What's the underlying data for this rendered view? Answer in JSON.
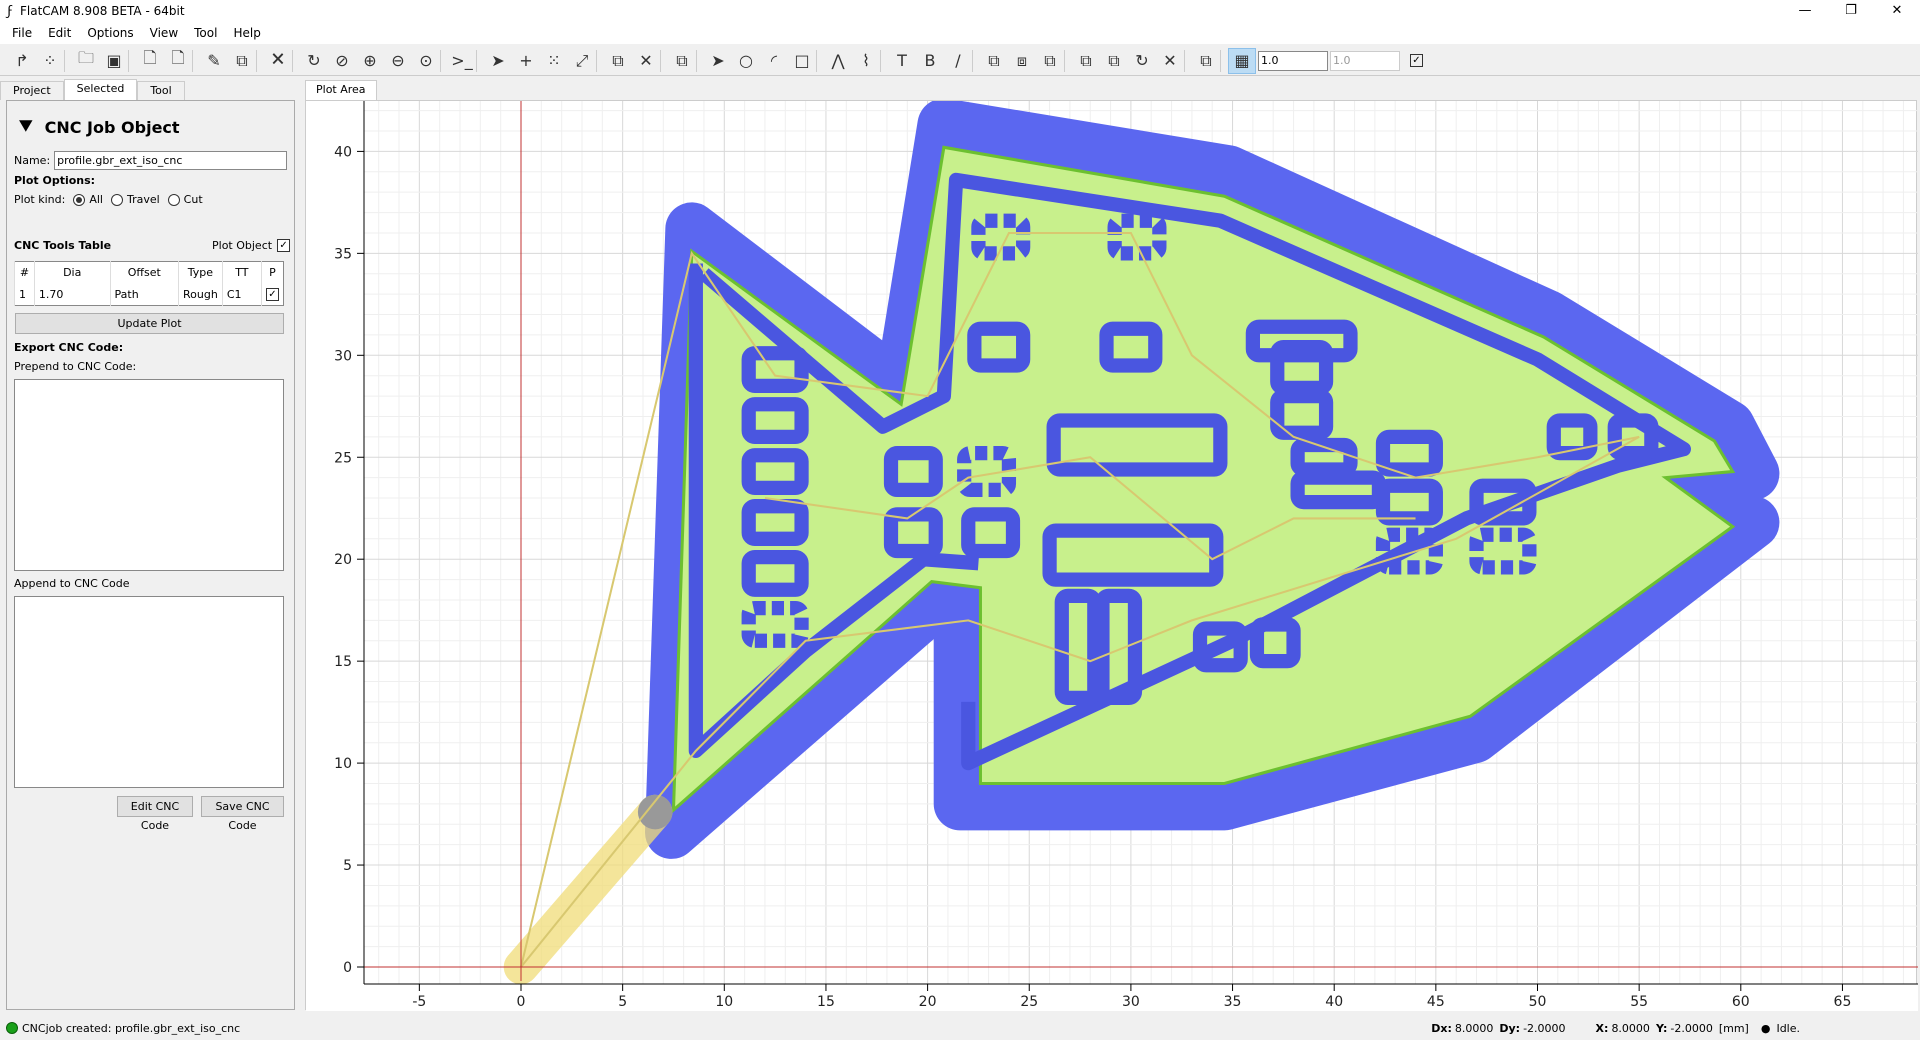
{
  "window": {
    "title": "FlatCAM 8.908 BETA - 64bit",
    "app_icon": "flatcam-icon",
    "controls": [
      "minimize-icon",
      "restore-icon",
      "close-icon"
    ]
  },
  "menu": [
    "File",
    "Edit",
    "Options",
    "View",
    "Tool",
    "Help"
  ],
  "toolbar": {
    "icons": [
      "new-geometry-icon",
      "new-excellon-icon",
      "sep",
      "open-icon",
      "save-icon",
      "sep",
      "open-gerber-icon",
      "open-excellon-icon",
      "sep",
      "open-project-icon",
      "copy-icon",
      "sep",
      "delete-icon",
      "sep",
      "replot-icon",
      "clear-plot-icon",
      "zoom-in-icon",
      "zoom-out-icon",
      "zoom-fit-icon",
      "sep",
      "shell-icon",
      "sep",
      "select-icon",
      "add-drill-icon",
      "drill-array-icon",
      "resize-drill-icon",
      "sep",
      "copy-drill-icon",
      "delete-drill-icon",
      "sep",
      "move-drill-icon",
      "sep",
      "select-geo-icon",
      "circle-icon",
      "arc-icon",
      "rectangle-icon",
      "sep",
      "polygon-icon",
      "path-icon",
      "sep",
      "text-icon",
      "buffer-icon",
      "paint-icon",
      "sep",
      "union-icon",
      "intersection-icon",
      "subtraction-icon",
      "sep",
      "cut-path-icon",
      "copy-geo-icon",
      "rotate-icon",
      "delete-geo-icon",
      "sep",
      "move-geo-icon",
      "sep"
    ],
    "grid_icon": "snap-grid-icon",
    "grid_x": "1.0",
    "grid_y": "1.0",
    "grid_lock_checked": true
  },
  "left_tabs": [
    "Project",
    "Selected",
    "Tool"
  ],
  "panel": {
    "title": "CNC Job Object",
    "title_icon": "cnc-drill-icon",
    "name_label": "Name:",
    "name_value": "profile.gbr_ext_iso_cnc",
    "plot_options": "Plot Options:",
    "plot_kind_label": "Plot kind:",
    "plot_kinds": [
      "All",
      "Travel",
      "Cut"
    ],
    "plot_kind_selected": "All",
    "tools_table_label": "CNC Tools Table",
    "plot_object_label": "Plot Object",
    "plot_object_checked": true,
    "table_headers": [
      "#",
      "Dia",
      "Offset",
      "Type",
      "TT",
      "P"
    ],
    "table_rows": [
      [
        "1",
        "1.70",
        "Path",
        "Rough",
        "C1",
        true
      ]
    ],
    "update_plot": "Update Plot",
    "export_label": "Export CNC Code:",
    "prepend_label": "Prepend to CNC Code:",
    "append_label": "Append to CNC Code",
    "prepend_value": "",
    "append_value": "",
    "edit_btn": "Edit CNC Code",
    "save_btn": "Save CNC Code"
  },
  "plot": {
    "tab": "Plot Area",
    "x_ticks": [
      "-5",
      "0",
      "5",
      "10",
      "15",
      "20",
      "25",
      "30",
      "35",
      "40",
      "45",
      "50",
      "55",
      "60",
      "65"
    ],
    "y_ticks": [
      "0",
      "5",
      "10",
      "15",
      "20",
      "25",
      "30",
      "35",
      "40"
    ],
    "colors": {
      "profile": "#5b67f0",
      "board": "#c8f08c",
      "outline": "#6cc030",
      "travel": "#f0dc78",
      "grid": "#e6e6e6",
      "axis": "#c03030"
    }
  },
  "status": {
    "message": "CNCjob created: profile.gbr_ext_iso_cnc",
    "dx_label": "Dx:",
    "dx": "8.0000",
    "dy_label": "Dy:",
    "dy": "-2.0000",
    "x_label": "X:",
    "x": "8.0000",
    "y_label": "Y:",
    "y": "-2.0000",
    "units": "[mm]",
    "state": "Idle."
  }
}
